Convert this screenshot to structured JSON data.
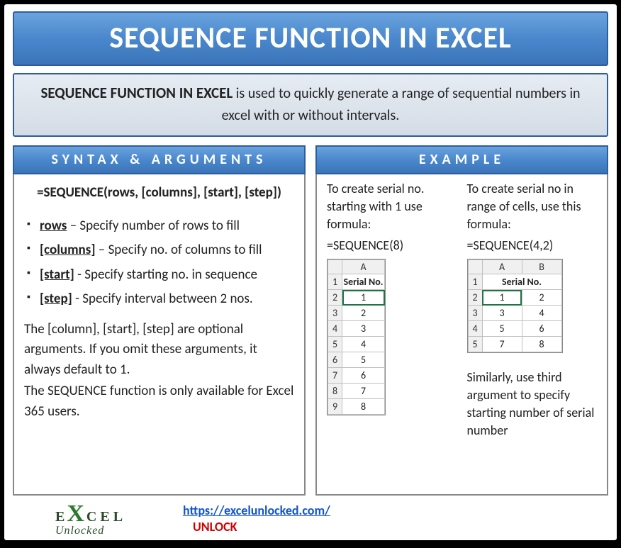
{
  "title": "SEQUENCE FUNCTION IN EXCEL",
  "intro": {
    "lead": "SEQUENCE FUNCTION IN EXCEL",
    "rest": " is used to quickly generate a range of sequential numbers in excel with or without intervals."
  },
  "left": {
    "heading": "SYNTAX & ARGUMENTS",
    "formula": "=SEQUENCE(rows, [columns], [start], [step])",
    "args": [
      {
        "name": "rows",
        "desc": " – Specify number of rows to fill"
      },
      {
        "name": "[columns]",
        "desc": " – Specify no. of columns to fill"
      },
      {
        "name": "[start]",
        "desc": " - Specify starting no. in sequence"
      },
      {
        "name": "[step]",
        "desc": " - Specify interval between 2  nos."
      }
    ],
    "note1": "The [column], [start], [step] are optional arguments. If you omit these arguments, it always default to 1.",
    "note2": "The SEQUENCE function is only available for Excel 365 users."
  },
  "right": {
    "heading": "EXAMPLE",
    "ex1": {
      "text": "To create serial no. starting with 1 use formula:",
      "formula": "=SEQUENCE(8)",
      "colLabel": "A",
      "header": "Serial No.",
      "rows": [
        "1",
        "2",
        "3",
        "4",
        "5",
        "6",
        "7",
        "8"
      ],
      "rowNums": [
        "1",
        "2",
        "3",
        "4",
        "5",
        "6",
        "7",
        "8",
        "9"
      ]
    },
    "ex2": {
      "text": "To create serial no in range of cells, use this formula:",
      "formula": "=SEQUENCE(4,2)",
      "colA": "A",
      "colB": "B",
      "header": "Serial No.",
      "rows": [
        [
          "1",
          "2"
        ],
        [
          "3",
          "4"
        ],
        [
          "5",
          "6"
        ],
        [
          "7",
          "8"
        ]
      ],
      "rowNums": [
        "1",
        "2",
        "3",
        "4",
        "5"
      ],
      "after": "Similarly, use third argument to specify starting number of serial number"
    }
  },
  "footer": {
    "logoTop": "E  CEL",
    "logoX": "X",
    "logoBottom": "Unlocked",
    "url": "https://excelunlocked.com/",
    "unlock": "UNLOCK"
  }
}
